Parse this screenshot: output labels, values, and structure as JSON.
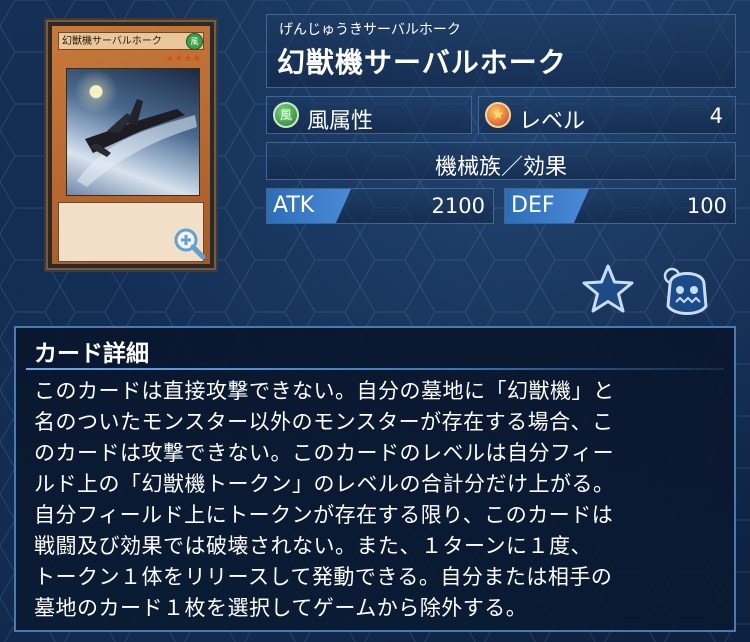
{
  "card": {
    "ruby": "げんじゅうきサーバルホーク",
    "name": "幻獣機サーバルホーク",
    "image_name": "幻獣機サーバルホーク",
    "image_attr_glyph": "風",
    "image_stars": "★★★★"
  },
  "attribute": {
    "glyph": "風",
    "label": "風属性"
  },
  "level": {
    "label": "レベル",
    "value": "4"
  },
  "type": {
    "label": "機械族／効果"
  },
  "atk": {
    "label": "ATK",
    "value": "2100"
  },
  "def": {
    "label": "DEF",
    "value": "100"
  },
  "detail": {
    "title": "カード詳細",
    "text": "このカードは直接攻撃できない。自分の墓地に「幻獣機」と\n名のついたモンスター以外のモンスターが存在する場合、こ\nのカードは攻撃できない。このカードのレベルは自分フィー\nルド上の「幻獣機トークン」のレベルの合計分だけ上がる。\n自分フィールド上にトークンが存在する限り、このカードは\n戦闘及び効果では破壊されない。また、１ターンに１度、\nトークン１体をリリースして発動できる。自分または相手の\n墓地のカード１枚を選択してゲームから除外する。"
  },
  "colors": {
    "background": "#0e2440",
    "panel_border": "#3f6690",
    "stat_tag": "#2d6db8",
    "wind": "#3aa04a",
    "level_star": "#d0381a"
  },
  "icons": [
    "zoom-icon",
    "wind-attribute-icon",
    "level-star-icon",
    "favorite-star-icon",
    "mask-icon"
  ]
}
